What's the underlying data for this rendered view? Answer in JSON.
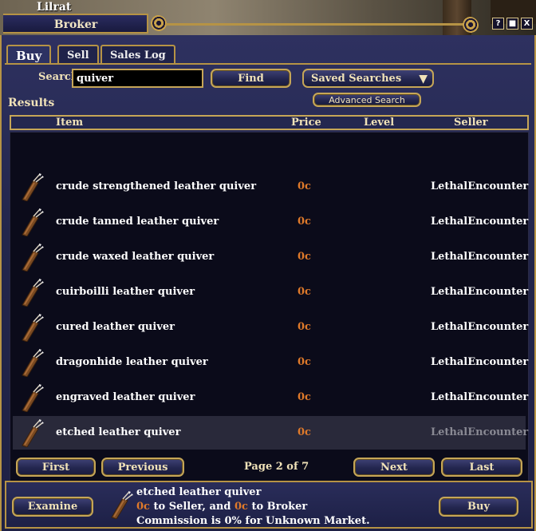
{
  "player_name": "Lilrat",
  "window": {
    "title": "Broker",
    "buttons": [
      "?",
      "■",
      "X"
    ]
  },
  "tabs": [
    {
      "label": "Buy",
      "active": true
    },
    {
      "label": "Sell",
      "active": false
    },
    {
      "label": "Sales Log",
      "active": false
    }
  ],
  "search": {
    "label": "Search",
    "value": "quiver",
    "find_label": "Find",
    "saved_searches_label": "Saved Searches",
    "advanced_label": "Advanced Search"
  },
  "results": {
    "label": "Results",
    "columns": {
      "item": "Item",
      "price": "Price",
      "level": "Level",
      "seller": "Seller"
    },
    "rows": [
      {
        "name": "crude strengthened leather quiver",
        "price": "0c",
        "level": "",
        "seller": "LethalEncounter",
        "icon": "quiver-icon",
        "selected": false
      },
      {
        "name": "crude tanned leather quiver",
        "price": "0c",
        "level": "",
        "seller": "LethalEncounter",
        "icon": "quiver-icon",
        "selected": false
      },
      {
        "name": "crude waxed leather quiver",
        "price": "0c",
        "level": "",
        "seller": "LethalEncounter",
        "icon": "quiver-icon",
        "selected": false
      },
      {
        "name": "cuirboilli leather quiver",
        "price": "0c",
        "level": "",
        "seller": "LethalEncounter",
        "icon": "quiver-icon",
        "selected": false
      },
      {
        "name": "cured leather quiver",
        "price": "0c",
        "level": "",
        "seller": "LethalEncounter",
        "icon": "quiver-icon",
        "selected": false
      },
      {
        "name": "dragonhide leather quiver",
        "price": "0c",
        "level": "",
        "seller": "LethalEncounter",
        "icon": "quiver-icon",
        "selected": false
      },
      {
        "name": "engraved leather quiver",
        "price": "0c",
        "level": "",
        "seller": "LethalEncounter",
        "icon": "quiver-icon",
        "selected": false
      },
      {
        "name": "etched leather quiver",
        "price": "0c",
        "level": "",
        "seller": "LethalEncounter",
        "icon": "quiver-icon",
        "selected": true
      }
    ]
  },
  "pagination": {
    "first": "First",
    "previous": "Previous",
    "page_info": "Page 2 of 7",
    "next": "Next",
    "last": "Last"
  },
  "footer": {
    "examine": "Examine",
    "selected_name": "etched leather quiver",
    "seller_fee": "0c",
    "to_seller": " to Seller, and ",
    "broker_fee": "0c",
    "to_broker": " to Broker",
    "commission": "Commission is 0% for Unknown Market.",
    "buy": "Buy",
    "icon": "quiver-icon"
  },
  "colors": {
    "gold_border": "#b69345",
    "price_orange": "#e07a2a",
    "panel_blue": "#23264c",
    "list_bg": "#0b0b1a"
  }
}
